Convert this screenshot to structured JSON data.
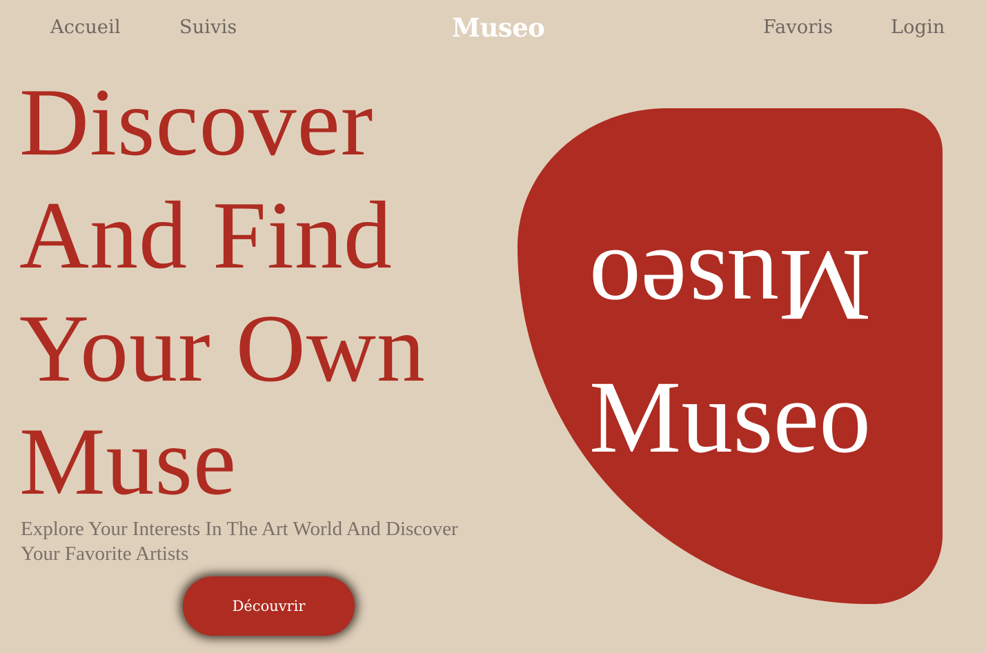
{
  "nav": {
    "accueil": "Accueil",
    "suivis": "Suivis",
    "brand": "Museo",
    "favoris": "Favoris",
    "login": "Login"
  },
  "hero": {
    "title_lines": [
      "Discover",
      "And Find",
      "Your Own",
      "Muse"
    ],
    "subtitle": "Explore Your Interests In The Art World And Discover Your Favorite Artists",
    "cta_label": "Découvrir"
  },
  "blob": {
    "flipped_text": "Museo",
    "upright_text": "Museo"
  },
  "colors": {
    "background": "#dfd0bc",
    "accent": "#ae2c21",
    "muted_text": "#7a7068",
    "white": "#ffffff"
  }
}
